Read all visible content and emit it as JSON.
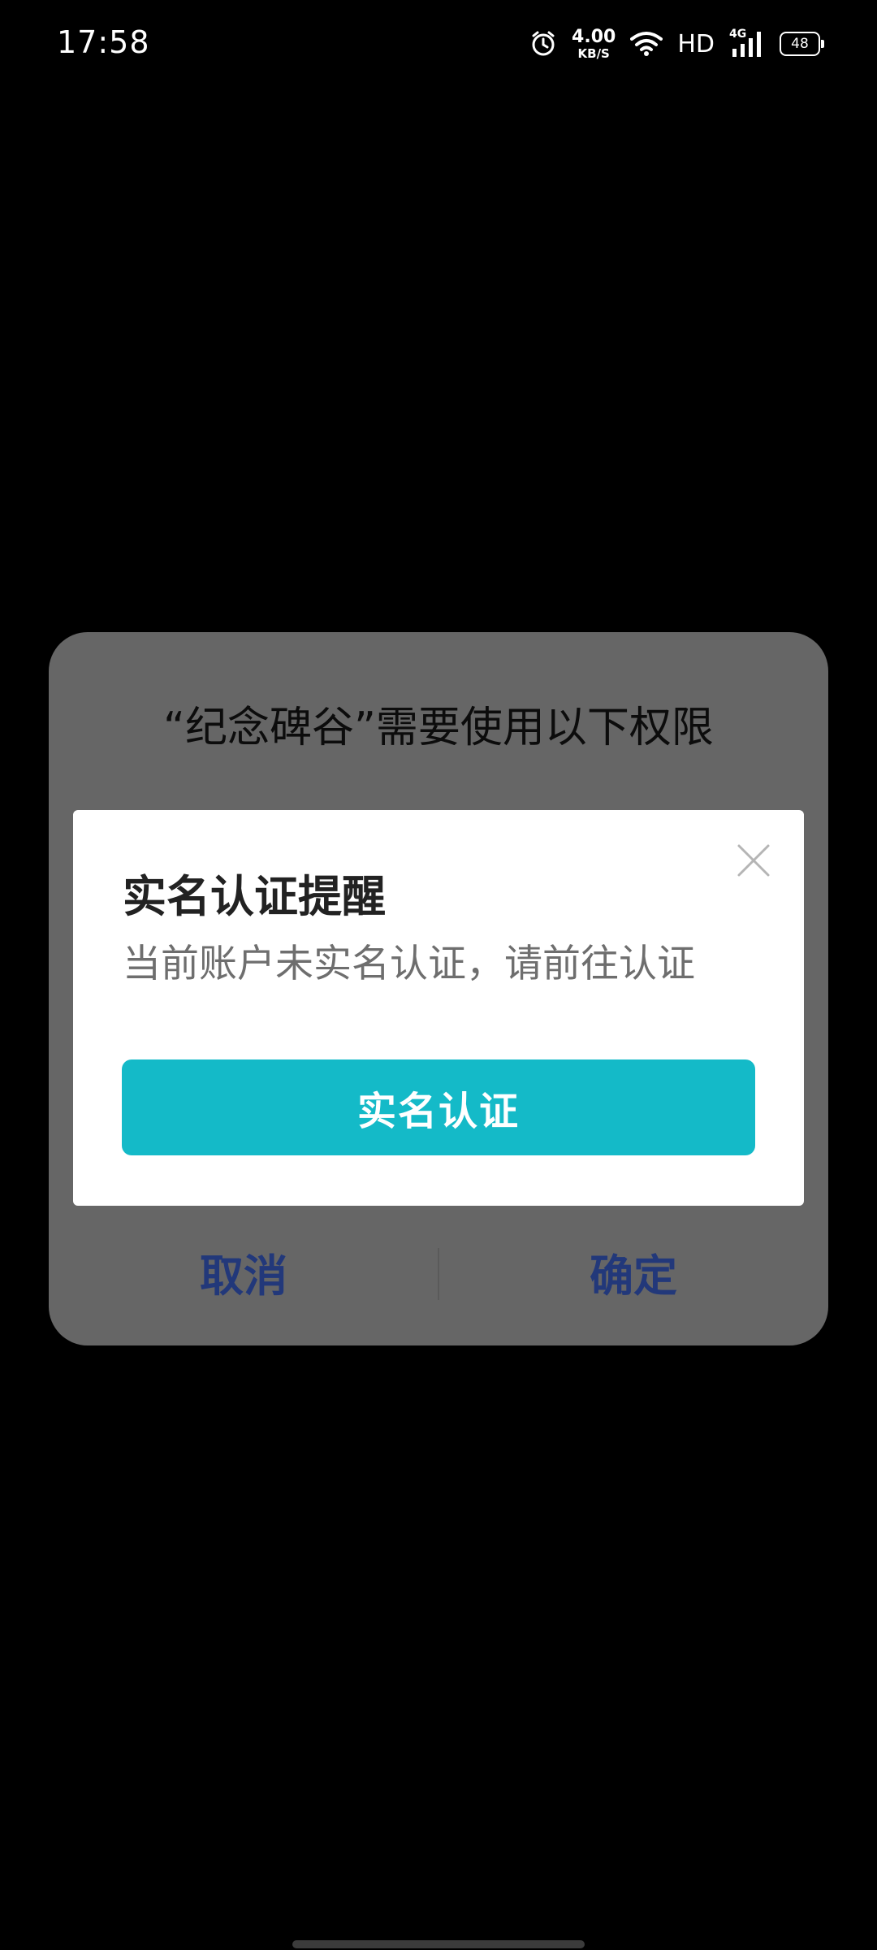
{
  "status_bar": {
    "time": "17:58",
    "net_speed_value": "4.00",
    "net_speed_unit": "KB/S",
    "hd_label": "HD",
    "network_label": "4G",
    "battery_level": "48",
    "icons": [
      "alarm-icon",
      "wifi-icon",
      "signal-icon",
      "battery-icon"
    ]
  },
  "permission_dialog": {
    "title": "“纪念碑谷”需要使用以下权限",
    "cancel_label": "取消",
    "confirm_label": "确定"
  },
  "realname_modal": {
    "title": "实名认证提醒",
    "description": "当前账户未实名认证，请前往认证",
    "button_label": "实名认证",
    "close_icon": "close-icon"
  },
  "colors": {
    "background": "#000000",
    "dialog_background": "#666666",
    "dialog_button_text": "#22387a",
    "modal_background": "#ffffff",
    "primary_button": "#14bac8"
  }
}
